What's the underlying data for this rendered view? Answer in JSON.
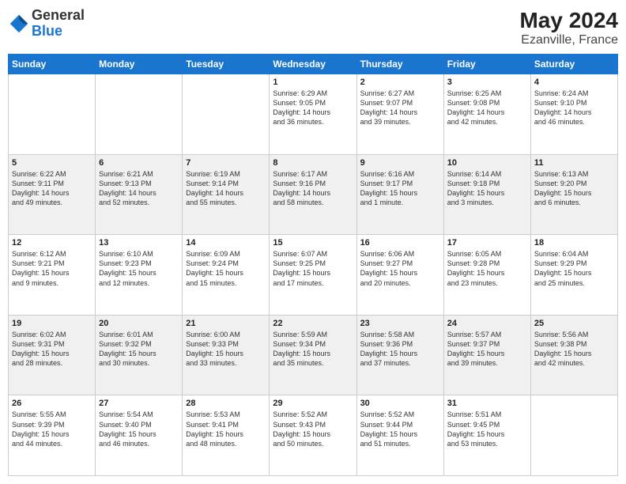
{
  "header": {
    "logo_general": "General",
    "logo_blue": "Blue",
    "month_year": "May 2024",
    "location": "Ezanville, France"
  },
  "weekdays": [
    "Sunday",
    "Monday",
    "Tuesday",
    "Wednesday",
    "Thursday",
    "Friday",
    "Saturday"
  ],
  "weeks": [
    [
      {
        "day": "",
        "info": ""
      },
      {
        "day": "",
        "info": ""
      },
      {
        "day": "",
        "info": ""
      },
      {
        "day": "1",
        "info": "Sunrise: 6:29 AM\nSunset: 9:05 PM\nDaylight: 14 hours\nand 36 minutes."
      },
      {
        "day": "2",
        "info": "Sunrise: 6:27 AM\nSunset: 9:07 PM\nDaylight: 14 hours\nand 39 minutes."
      },
      {
        "day": "3",
        "info": "Sunrise: 6:25 AM\nSunset: 9:08 PM\nDaylight: 14 hours\nand 42 minutes."
      },
      {
        "day": "4",
        "info": "Sunrise: 6:24 AM\nSunset: 9:10 PM\nDaylight: 14 hours\nand 46 minutes."
      }
    ],
    [
      {
        "day": "5",
        "info": "Sunrise: 6:22 AM\nSunset: 9:11 PM\nDaylight: 14 hours\nand 49 minutes."
      },
      {
        "day": "6",
        "info": "Sunrise: 6:21 AM\nSunset: 9:13 PM\nDaylight: 14 hours\nand 52 minutes."
      },
      {
        "day": "7",
        "info": "Sunrise: 6:19 AM\nSunset: 9:14 PM\nDaylight: 14 hours\nand 55 minutes."
      },
      {
        "day": "8",
        "info": "Sunrise: 6:17 AM\nSunset: 9:16 PM\nDaylight: 14 hours\nand 58 minutes."
      },
      {
        "day": "9",
        "info": "Sunrise: 6:16 AM\nSunset: 9:17 PM\nDaylight: 15 hours\nand 1 minute."
      },
      {
        "day": "10",
        "info": "Sunrise: 6:14 AM\nSunset: 9:18 PM\nDaylight: 15 hours\nand 3 minutes."
      },
      {
        "day": "11",
        "info": "Sunrise: 6:13 AM\nSunset: 9:20 PM\nDaylight: 15 hours\nand 6 minutes."
      }
    ],
    [
      {
        "day": "12",
        "info": "Sunrise: 6:12 AM\nSunset: 9:21 PM\nDaylight: 15 hours\nand 9 minutes."
      },
      {
        "day": "13",
        "info": "Sunrise: 6:10 AM\nSunset: 9:23 PM\nDaylight: 15 hours\nand 12 minutes."
      },
      {
        "day": "14",
        "info": "Sunrise: 6:09 AM\nSunset: 9:24 PM\nDaylight: 15 hours\nand 15 minutes."
      },
      {
        "day": "15",
        "info": "Sunrise: 6:07 AM\nSunset: 9:25 PM\nDaylight: 15 hours\nand 17 minutes."
      },
      {
        "day": "16",
        "info": "Sunrise: 6:06 AM\nSunset: 9:27 PM\nDaylight: 15 hours\nand 20 minutes."
      },
      {
        "day": "17",
        "info": "Sunrise: 6:05 AM\nSunset: 9:28 PM\nDaylight: 15 hours\nand 23 minutes."
      },
      {
        "day": "18",
        "info": "Sunrise: 6:04 AM\nSunset: 9:29 PM\nDaylight: 15 hours\nand 25 minutes."
      }
    ],
    [
      {
        "day": "19",
        "info": "Sunrise: 6:02 AM\nSunset: 9:31 PM\nDaylight: 15 hours\nand 28 minutes."
      },
      {
        "day": "20",
        "info": "Sunrise: 6:01 AM\nSunset: 9:32 PM\nDaylight: 15 hours\nand 30 minutes."
      },
      {
        "day": "21",
        "info": "Sunrise: 6:00 AM\nSunset: 9:33 PM\nDaylight: 15 hours\nand 33 minutes."
      },
      {
        "day": "22",
        "info": "Sunrise: 5:59 AM\nSunset: 9:34 PM\nDaylight: 15 hours\nand 35 minutes."
      },
      {
        "day": "23",
        "info": "Sunrise: 5:58 AM\nSunset: 9:36 PM\nDaylight: 15 hours\nand 37 minutes."
      },
      {
        "day": "24",
        "info": "Sunrise: 5:57 AM\nSunset: 9:37 PM\nDaylight: 15 hours\nand 39 minutes."
      },
      {
        "day": "25",
        "info": "Sunrise: 5:56 AM\nSunset: 9:38 PM\nDaylight: 15 hours\nand 42 minutes."
      }
    ],
    [
      {
        "day": "26",
        "info": "Sunrise: 5:55 AM\nSunset: 9:39 PM\nDaylight: 15 hours\nand 44 minutes."
      },
      {
        "day": "27",
        "info": "Sunrise: 5:54 AM\nSunset: 9:40 PM\nDaylight: 15 hours\nand 46 minutes."
      },
      {
        "day": "28",
        "info": "Sunrise: 5:53 AM\nSunset: 9:41 PM\nDaylight: 15 hours\nand 48 minutes."
      },
      {
        "day": "29",
        "info": "Sunrise: 5:52 AM\nSunset: 9:43 PM\nDaylight: 15 hours\nand 50 minutes."
      },
      {
        "day": "30",
        "info": "Sunrise: 5:52 AM\nSunset: 9:44 PM\nDaylight: 15 hours\nand 51 minutes."
      },
      {
        "day": "31",
        "info": "Sunrise: 5:51 AM\nSunset: 9:45 PM\nDaylight: 15 hours\nand 53 minutes."
      },
      {
        "day": "",
        "info": ""
      }
    ]
  ]
}
